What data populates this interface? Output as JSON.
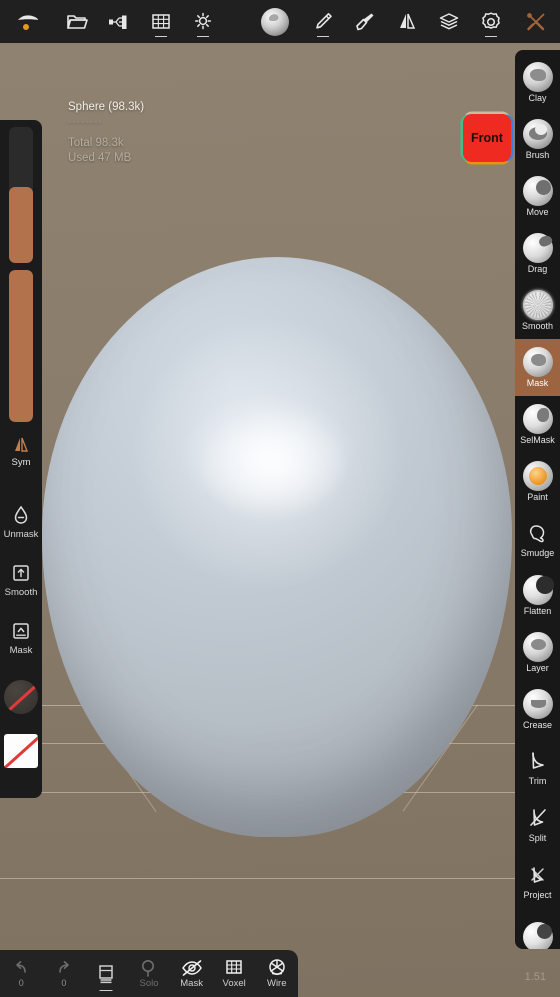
{
  "app": {
    "version_label": "1.51",
    "background_color": "#8b7b68",
    "accent_color": "#b2724c",
    "active_tool_color": "#9c6440",
    "panel_color": "#1b1b1b"
  },
  "topbar": {
    "items": [
      {
        "name": "scene-icon",
        "label": "Scene",
        "sub": "none"
      },
      {
        "name": "files-icon",
        "label": "Files",
        "sub": "none"
      },
      {
        "name": "topology-icon",
        "label": "Topology",
        "sub": "none"
      },
      {
        "name": "grid-icon",
        "label": "Grid",
        "sub": "single"
      },
      {
        "name": "lighting-icon",
        "label": "Lighting",
        "sub": "single"
      },
      {
        "name": "material-icon",
        "label": "Material",
        "sub": "none"
      },
      {
        "name": "stroke-icon",
        "label": "Stroke",
        "sub": "single"
      },
      {
        "name": "paint-icon",
        "label": "Paint",
        "sub": "none"
      },
      {
        "name": "symmetry-icon",
        "label": "Symmetry",
        "sub": "none"
      },
      {
        "name": "layers-icon",
        "label": "Layers",
        "sub": "none"
      },
      {
        "name": "settings-icon",
        "label": "Settings",
        "sub": "single"
      },
      {
        "name": "tools-icon",
        "label": "Tools",
        "sub": "none"
      }
    ]
  },
  "viewport": {
    "object_info": {
      "title": "Sphere (98.3k)",
      "divider": "--------",
      "total": "Total 98.3k",
      "used": "Used 47 MB"
    },
    "gizmo": {
      "label": "Front",
      "face_color": "#ef2a20",
      "edge_left_color": "#3fbf8c",
      "edge_right_color": "#3f7fe0",
      "edge_bottom_color": "#e8920f",
      "edge_top_color": "#c9bba4"
    },
    "grid_lines_y": [
      705,
      743,
      792,
      878
    ],
    "mesh_name": "Sphere"
  },
  "left_panel": {
    "sliders": [
      {
        "name": "radius-slider",
        "value_percent": 56
      },
      {
        "name": "intensity-slider",
        "value_percent": 100
      }
    ],
    "items": [
      {
        "name": "sym-toggle",
        "label": "Sym",
        "icon": "symmetry-icon"
      },
      {
        "name": "unmask-button",
        "label": "Unmask",
        "icon": "unmask-drop-icon"
      },
      {
        "name": "smooth-button",
        "label": "Smooth",
        "icon": "smooth-up-icon"
      },
      {
        "name": "mask-button",
        "label": "Mask",
        "icon": "mask-up-icon"
      }
    ],
    "swatches": [
      {
        "name": "alpha-swatch",
        "shape": "circle",
        "disabled": true
      },
      {
        "name": "texture-swatch",
        "shape": "square",
        "disabled": true
      }
    ]
  },
  "right_panel": {
    "active_tool": "Mask",
    "tools": [
      {
        "name": "tool-clay",
        "label": "Clay",
        "icon": "clay-orb-icon",
        "active": false
      },
      {
        "name": "tool-brush",
        "label": "Brush",
        "icon": "brush-orb-icon",
        "active": false
      },
      {
        "name": "tool-move",
        "label": "Move",
        "icon": "move-orb-icon",
        "active": false
      },
      {
        "name": "tool-drag",
        "label": "Drag",
        "icon": "drag-orb-icon",
        "active": false
      },
      {
        "name": "tool-smooth",
        "label": "Smooth",
        "icon": "smooth-orb-icon",
        "active": false
      },
      {
        "name": "tool-mask",
        "label": "Mask",
        "icon": "mask-orb-icon",
        "active": true
      },
      {
        "name": "tool-selmask",
        "label": "SelMask",
        "icon": "selmask-orb-icon",
        "active": false
      },
      {
        "name": "tool-paint",
        "label": "Paint",
        "icon": "paint-orb-icon",
        "active": false
      },
      {
        "name": "tool-smudge",
        "label": "Smudge",
        "icon": "smudge-icon",
        "active": false
      },
      {
        "name": "tool-flatten",
        "label": "Flatten",
        "icon": "flatten-orb-icon",
        "active": false
      },
      {
        "name": "tool-layer",
        "label": "Layer",
        "icon": "layer-orb-icon",
        "active": false
      },
      {
        "name": "tool-crease",
        "label": "Crease",
        "icon": "crease-orb-icon",
        "active": false
      },
      {
        "name": "tool-trim",
        "label": "Trim",
        "icon": "trim-icon",
        "active": false
      },
      {
        "name": "tool-split",
        "label": "Split",
        "icon": "split-icon",
        "active": false
      },
      {
        "name": "tool-project",
        "label": "Project",
        "icon": "project-icon",
        "active": false
      },
      {
        "name": "tool-next",
        "label": "",
        "icon": "next-orb-icon",
        "active": false
      }
    ]
  },
  "bottom_bar": {
    "items": [
      {
        "name": "undo-button",
        "label": "0",
        "icon": "undo-icon",
        "dim": true,
        "sub": false
      },
      {
        "name": "redo-button",
        "label": "0",
        "icon": "redo-icon",
        "dim": true,
        "sub": false
      },
      {
        "name": "layers-button",
        "label": "",
        "icon": "pages-icon",
        "dim": false,
        "sub": true
      },
      {
        "name": "solo-toggle",
        "label": "Solo",
        "icon": "solo-icon",
        "dim": true,
        "sub": false
      },
      {
        "name": "mask-toggle",
        "label": "Mask",
        "icon": "eye-off-icon",
        "dim": false,
        "sub": false
      },
      {
        "name": "voxel-button",
        "label": "Voxel",
        "icon": "voxel-icon",
        "dim": false,
        "sub": false
      },
      {
        "name": "wire-toggle",
        "label": "Wire",
        "icon": "wire-icon",
        "dim": false,
        "sub": false
      }
    ]
  }
}
